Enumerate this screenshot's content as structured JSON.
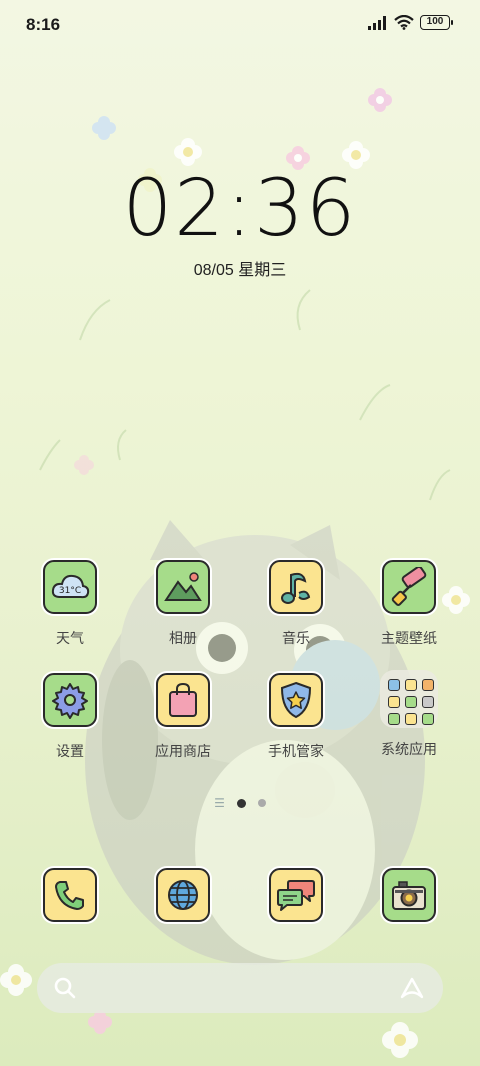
{
  "status_bar": {
    "time": "8:16",
    "battery": "100"
  },
  "clock": {
    "time": "02:36",
    "date": "08/05 星期三"
  },
  "apps": [
    {
      "label": "天气",
      "icon": "weather-icon",
      "badge": "31°C"
    },
    {
      "label": "相册",
      "icon": "gallery-icon"
    },
    {
      "label": "音乐",
      "icon": "music-icon"
    },
    {
      "label": "主题壁纸",
      "icon": "paint-roller-icon"
    },
    {
      "label": "设置",
      "icon": "gear-icon"
    },
    {
      "label": "应用商店",
      "icon": "shopping-bag-icon"
    },
    {
      "label": "手机管家",
      "icon": "shield-star-icon"
    },
    {
      "label": "系统应用",
      "icon": "folder-icon"
    }
  ],
  "dock": [
    {
      "icon": "phone-icon"
    },
    {
      "icon": "browser-globe-icon"
    },
    {
      "icon": "messages-icon"
    },
    {
      "icon": "camera-icon"
    }
  ],
  "pager": {
    "pages": 2,
    "active": 1
  },
  "colors": {
    "green_tile": "#a6dc8a",
    "yellow_tile": "#fbe490",
    "outline": "#2a2a2a"
  }
}
